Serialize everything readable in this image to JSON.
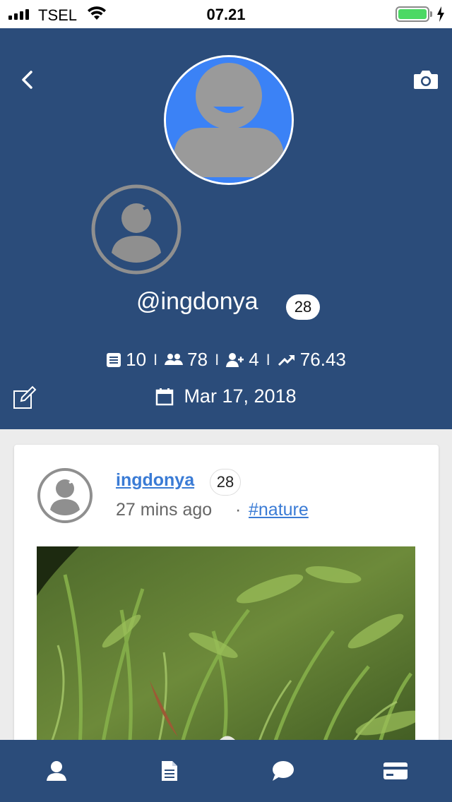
{
  "status_bar": {
    "carrier": "TSEL",
    "time": "07.21",
    "battery_level": 1.0,
    "battery_color": "#4cd964"
  },
  "header": {
    "background": "#2b4c7a",
    "back_icon": "chevron-left-icon",
    "camera_icon": "camera-icon",
    "username": "@ingdonya",
    "level": "28",
    "stats": {
      "posts": "10",
      "posts_icon": "document-icon",
      "followers": "78",
      "followers_icon": "people-icon",
      "following": "4",
      "following_icon": "add-person-icon",
      "score": "76.43",
      "score_icon": "trending-up-icon",
      "separator": "I"
    },
    "edit_icon": "edit-icon",
    "joined_icon": "calendar-icon",
    "joined_date": "Mar 17, 2018"
  },
  "post": {
    "author": "ingdonya",
    "author_level": "28",
    "time_ago": "27 mins ago",
    "separator": "·",
    "tag": "#nature",
    "link_color": "#3a7bd5"
  },
  "bottom_nav": {
    "items": [
      {
        "icon": "profile-icon"
      },
      {
        "icon": "document-icon"
      },
      {
        "icon": "chat-icon"
      },
      {
        "icon": "card-icon"
      }
    ]
  }
}
